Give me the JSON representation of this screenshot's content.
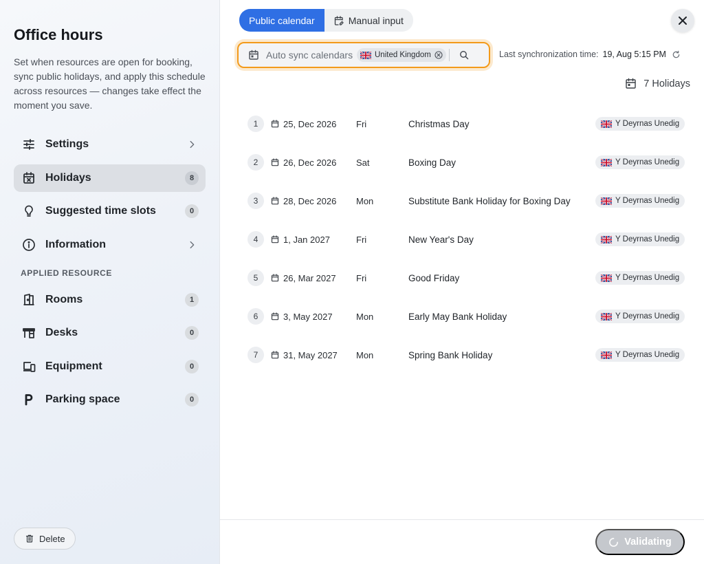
{
  "sidebar": {
    "title": "Office hours",
    "description": "Set when resources are open for booking, sync public holidays, and apply this schedule across resources — changes take effect the moment you save.",
    "items": [
      {
        "label": "Settings",
        "icon": "sliders-icon"
      },
      {
        "label": "Holidays",
        "icon": "calendar-x-icon",
        "badge": "8"
      },
      {
        "label": "Suggested time slots",
        "icon": "lightbulb-icon",
        "badge": "0"
      },
      {
        "label": "Information",
        "icon": "info-icon"
      }
    ],
    "section_label": "APPLIED RESOURCE",
    "resources": [
      {
        "label": "Rooms",
        "icon": "door-icon",
        "badge": "1"
      },
      {
        "label": "Desks",
        "icon": "desk-icon",
        "badge": "0"
      },
      {
        "label": "Equipment",
        "icon": "devices-icon",
        "badge": "0"
      },
      {
        "label": "Parking space",
        "icon": "parking-icon",
        "badge": "0"
      }
    ],
    "delete_label": "Delete"
  },
  "tabs": {
    "public_calendar": "Public calendar",
    "manual_input": "Manual input"
  },
  "sync": {
    "placeholder": "Auto sync calendars",
    "country": "United Kingdom",
    "last_sync_label": "Last synchronization time:",
    "last_sync_value": "19, Aug 5:15 PM"
  },
  "holiday_count": "7 Holidays",
  "holidays": [
    {
      "num": "1",
      "date": "25, Dec 2026",
      "day": "Fri",
      "name": "Christmas Day",
      "region": "Y Deyrnas Unedig"
    },
    {
      "num": "2",
      "date": "26, Dec 2026",
      "day": "Sat",
      "name": "Boxing Day",
      "region": "Y Deyrnas Unedig"
    },
    {
      "num": "3",
      "date": "28, Dec 2026",
      "day": "Mon",
      "name": "Substitute Bank Holiday for Boxing Day",
      "region": "Y Deyrnas Unedig"
    },
    {
      "num": "4",
      "date": "1, Jan 2027",
      "day": "Fri",
      "name": "New Year's Day",
      "region": "Y Deyrnas Unedig"
    },
    {
      "num": "5",
      "date": "26, Mar 2027",
      "day": "Fri",
      "name": "Good Friday",
      "region": "Y Deyrnas Unedig"
    },
    {
      "num": "6",
      "date": "3, May 2027",
      "day": "Mon",
      "name": "Early May Bank Holiday",
      "region": "Y Deyrnas Unedig"
    },
    {
      "num": "7",
      "date": "31, May 2027",
      "day": "Mon",
      "name": "Spring Bank Holiday",
      "region": "Y Deyrnas Unedig"
    }
  ],
  "footer": {
    "validate_label": "Validating"
  },
  "colors": {
    "accent": "#2f6fe4",
    "focus_ring": "#f39a1a",
    "disabled_button": "#c5c8cd"
  }
}
